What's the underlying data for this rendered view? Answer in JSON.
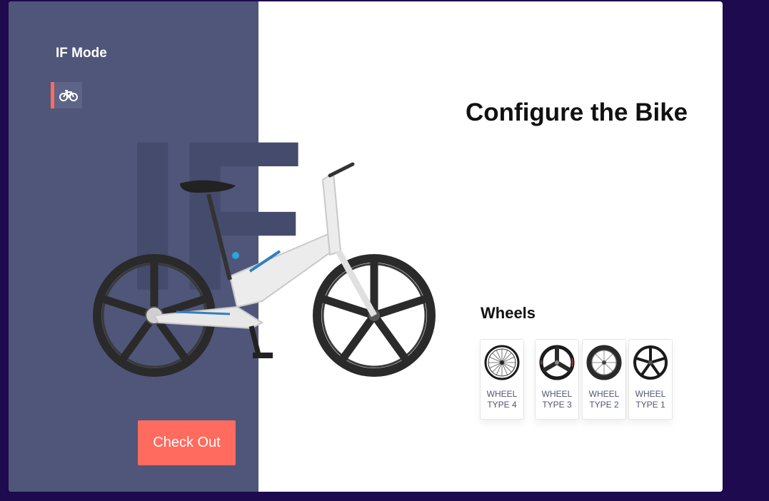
{
  "sidebar": {
    "title": "IF Mode",
    "watermark": "IF",
    "mode_icon": "bicycle-icon",
    "checkout_label": "Check Out"
  },
  "main": {
    "title": "Configure the Bike",
    "wheels_heading": "Wheels",
    "wheel_options": [
      {
        "label": "WHEEL TYPE 4",
        "icon": "spoked-wheel-icon"
      },
      {
        "label": "WHEEL TYPE 3",
        "icon": "tri-spoke-wheel-icon"
      },
      {
        "label": "WHEEL TYPE 2",
        "icon": "deep-rim-wheel-icon"
      },
      {
        "label": "WHEEL TYPE 1",
        "icon": "five-spoke-wheel-icon"
      }
    ]
  },
  "colors": {
    "background": "#1e0a4f",
    "sidebar": "#4f5679",
    "accent": "#ff6b5e",
    "card": "#ffffff"
  }
}
